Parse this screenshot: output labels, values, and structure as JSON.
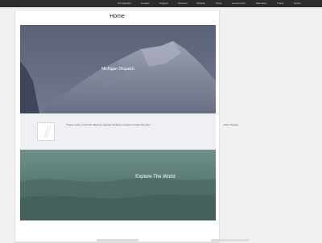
{
  "nav": {
    "items": [
      "NC Dispatch",
      "Contact",
      "Projects",
      "Services",
      "Weather",
      "Press",
      "Government",
      "Education",
      "Travel",
      "Sports"
    ]
  },
  "page": {
    "title": "Home"
  },
  "hero": {
    "caption": "Michigan Dispatch"
  },
  "quote": {
    "text": "\"Fusce sedes commodo habentes aperiant facilissa mesasrio occasio liberatio.\"",
    "side_text": "- Adam Swader"
  },
  "explore": {
    "caption": "Explore The World"
  },
  "colors": {
    "nav_bg": "#2c2c2c",
    "page_bg": "#f1f1f1",
    "hero_tint": "#6e7388",
    "explore_tint": "#50736c"
  }
}
